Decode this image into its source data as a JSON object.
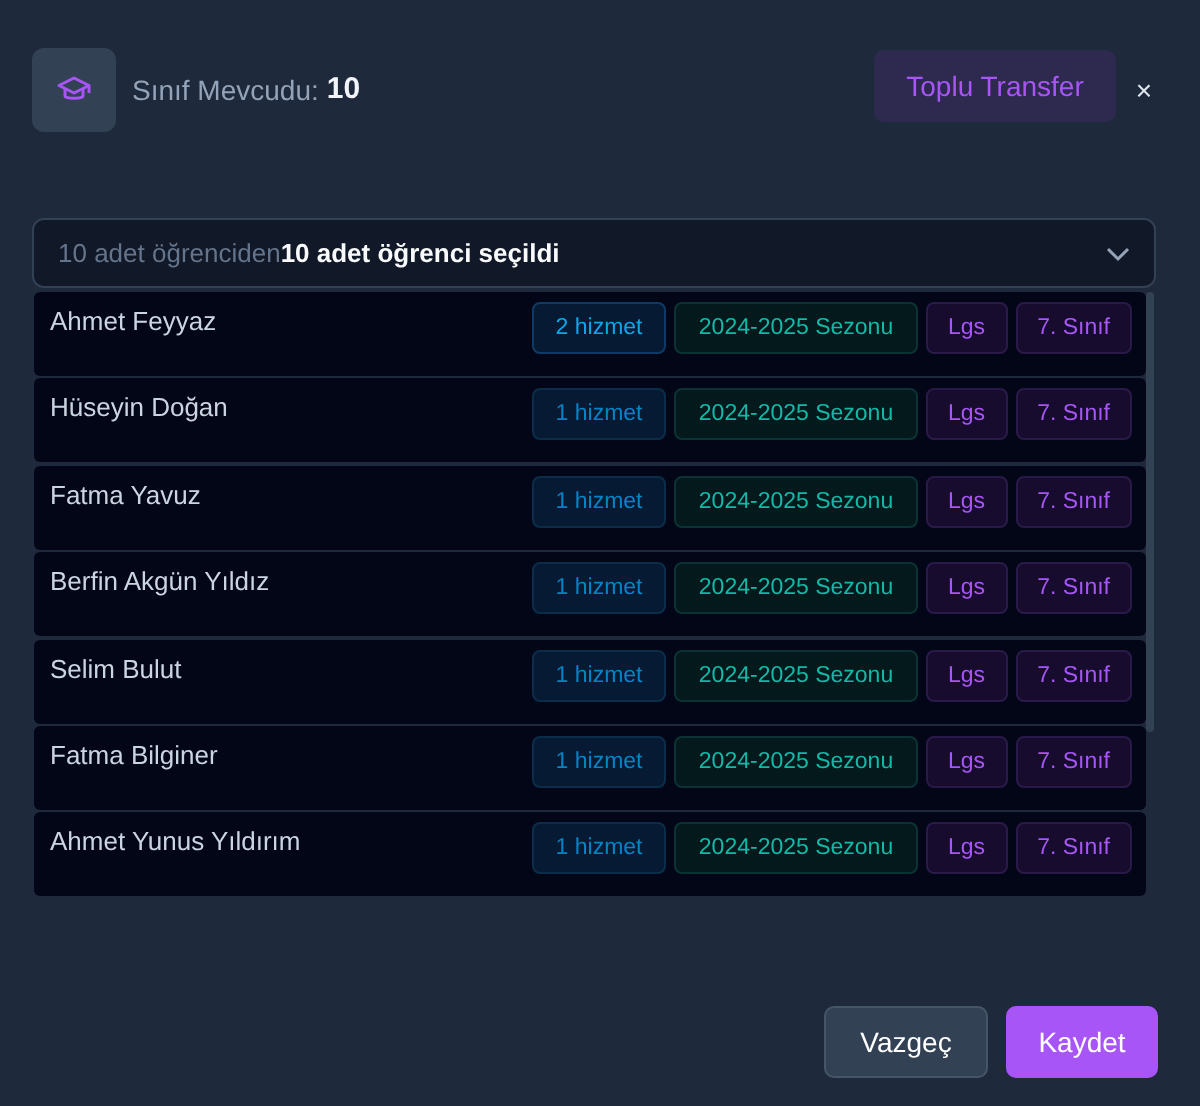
{
  "header": {
    "label": "Sınıf Mevcudu:",
    "count": "10",
    "transfer_button": "Toplu Transfer",
    "close": "×"
  },
  "selector": {
    "prefix": "10 adet öğrenciden",
    "selected_text": "10 adet öğrenci seçildi"
  },
  "students": [
    {
      "name": "Ahmet Feyyaz",
      "tags": [
        {
          "kind": "service",
          "text": "2 hizmet",
          "selected": true
        },
        {
          "kind": "season",
          "text": "2024-2025 Sezonu"
        },
        {
          "kind": "program",
          "text": "Lgs"
        },
        {
          "kind": "program",
          "text": "7. Sınıf"
        }
      ]
    },
    {
      "name": "Hüseyin Doğan",
      "tags": [
        {
          "kind": "service",
          "text": "1 hizmet",
          "selected": false
        },
        {
          "kind": "season",
          "text": "2024-2025 Sezonu"
        },
        {
          "kind": "program",
          "text": "Lgs"
        },
        {
          "kind": "program",
          "text": "7. Sınıf"
        }
      ]
    },
    {
      "name": "Fatma Yavuz",
      "tags": [
        {
          "kind": "service",
          "text": "1 hizmet",
          "selected": false
        },
        {
          "kind": "season",
          "text": "2024-2025 Sezonu"
        },
        {
          "kind": "program",
          "text": "Lgs"
        },
        {
          "kind": "program",
          "text": "7. Sınıf"
        }
      ]
    },
    {
      "name": "Berfin Akgün Yıldız",
      "tags": [
        {
          "kind": "service",
          "text": "1 hizmet",
          "selected": false
        },
        {
          "kind": "season",
          "text": "2024-2025 Sezonu"
        },
        {
          "kind": "program",
          "text": "Lgs"
        },
        {
          "kind": "program",
          "text": "7. Sınıf"
        }
      ]
    },
    {
      "name": "Selim Bulut",
      "tags": [
        {
          "kind": "service",
          "text": "1 hizmet",
          "selected": false
        },
        {
          "kind": "season",
          "text": "2024-2025 Sezonu"
        },
        {
          "kind": "program",
          "text": "Lgs"
        },
        {
          "kind": "program",
          "text": "7. Sınıf"
        }
      ]
    },
    {
      "name": "Fatma Bilginer",
      "tags": [
        {
          "kind": "service",
          "text": "1 hizmet",
          "selected": false
        },
        {
          "kind": "season",
          "text": "2024-2025 Sezonu"
        },
        {
          "kind": "program",
          "text": "Lgs"
        },
        {
          "kind": "program",
          "text": "7. Sınıf"
        }
      ]
    },
    {
      "name": "Ahmet Yunus Yıldırım",
      "tags": [
        {
          "kind": "service",
          "text": "1 hizmet",
          "selected": false
        },
        {
          "kind": "season",
          "text": "2024-2025 Sezonu"
        },
        {
          "kind": "program",
          "text": "Lgs"
        },
        {
          "kind": "program",
          "text": "7. Sınıf"
        }
      ]
    }
  ],
  "footer": {
    "cancel": "Vazgeç",
    "save": "Kaydet"
  }
}
